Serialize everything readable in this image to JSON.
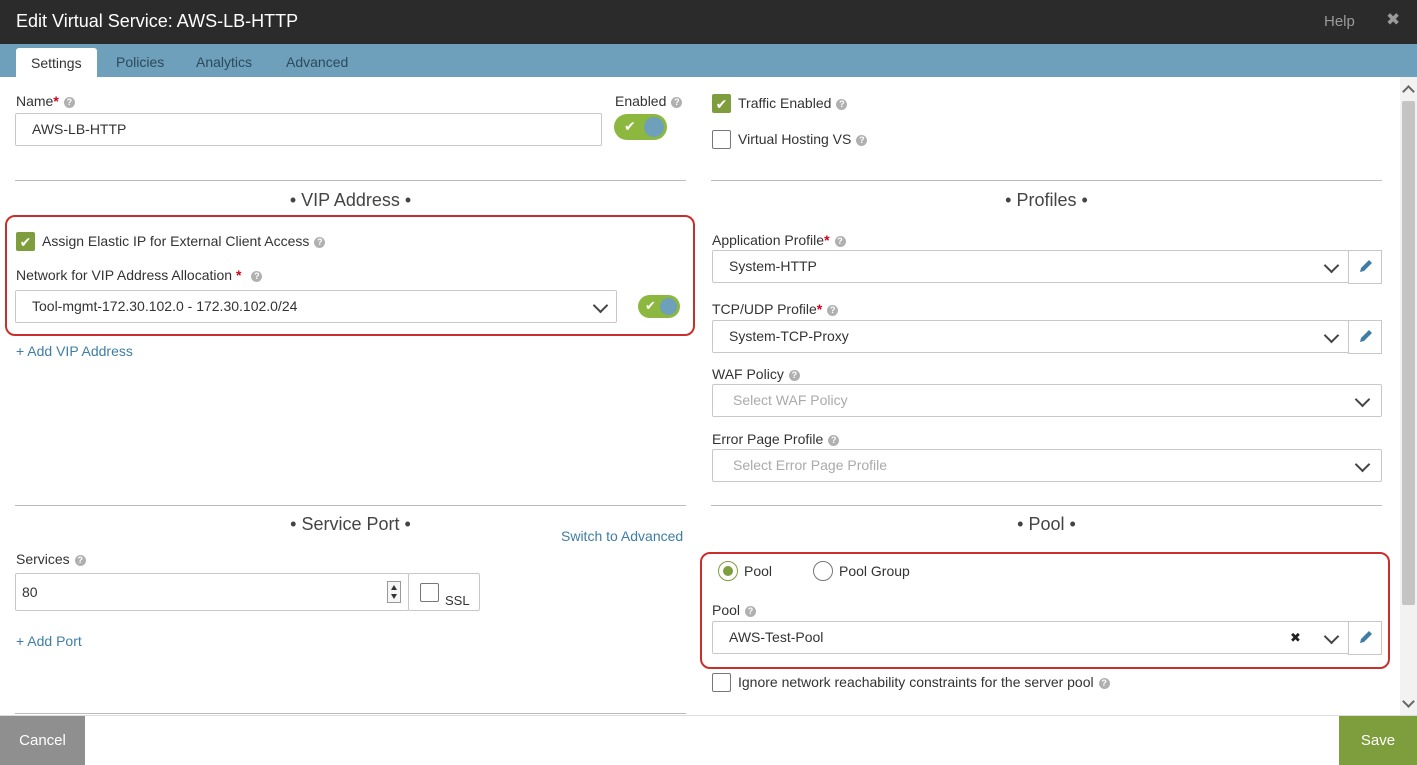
{
  "window": {
    "title": "Edit Virtual Service: AWS-LB-HTTP",
    "help": "Help",
    "close_icon": "close-icon"
  },
  "tabs": [
    {
      "label": "Settings",
      "active": true
    },
    {
      "label": "Policies",
      "active": false
    },
    {
      "label": "Analytics",
      "active": false
    },
    {
      "label": "Advanced",
      "active": false
    }
  ],
  "name": {
    "label": "Name",
    "value": "AWS-LB-HTTP"
  },
  "enabled": {
    "label": "Enabled",
    "on": true
  },
  "traffic_enabled": {
    "label": "Traffic Enabled",
    "checked": true
  },
  "virtual_hosting": {
    "label": "Virtual Hosting VS",
    "checked": false
  },
  "vip": {
    "title": "• VIP Address •",
    "assign_eip": {
      "label": "Assign Elastic IP for External Client Access",
      "checked": true
    },
    "network_label": "Network for VIP Address Allocation",
    "network_value": "Tool-mgmt-172.30.102.0 - 172.30.102.0/24",
    "toggle_on": true,
    "add_link": "+ Add VIP Address"
  },
  "profiles": {
    "title": "• Profiles •",
    "application_profile": {
      "label": "Application Profile",
      "value": "System-HTTP"
    },
    "tcp_udp_profile": {
      "label": "TCP/UDP Profile",
      "value": "System-TCP-Proxy"
    },
    "waf_policy": {
      "label": "WAF Policy",
      "placeholder": "Select WAF Policy"
    },
    "error_page_profile": {
      "label": "Error Page Profile",
      "placeholder": "Select Error Page Profile"
    }
  },
  "service_port": {
    "title": "• Service Port •",
    "switch_link": "Switch to Advanced",
    "services_label": "Services",
    "port_value": "80",
    "ssl_label": "SSL",
    "ssl_checked": false,
    "add_link": "+ Add Port"
  },
  "pool": {
    "title": "• Pool •",
    "radio_pool": "Pool",
    "radio_pool_group": "Pool Group",
    "selected": "Pool",
    "pool_label": "Pool",
    "pool_value": "AWS-Test-Pool",
    "clear_icon": "✖",
    "ignore_label": "Ignore network reachability constraints for the server pool",
    "ignore_checked": false
  },
  "footer": {
    "cancel": "Cancel",
    "save": "Save"
  },
  "colors": {
    "accent_green": "#7e9d3d",
    "tab_blue": "#6e9fbb",
    "highlight_red": "#c9302c",
    "link_blue": "#3e7ea6"
  }
}
